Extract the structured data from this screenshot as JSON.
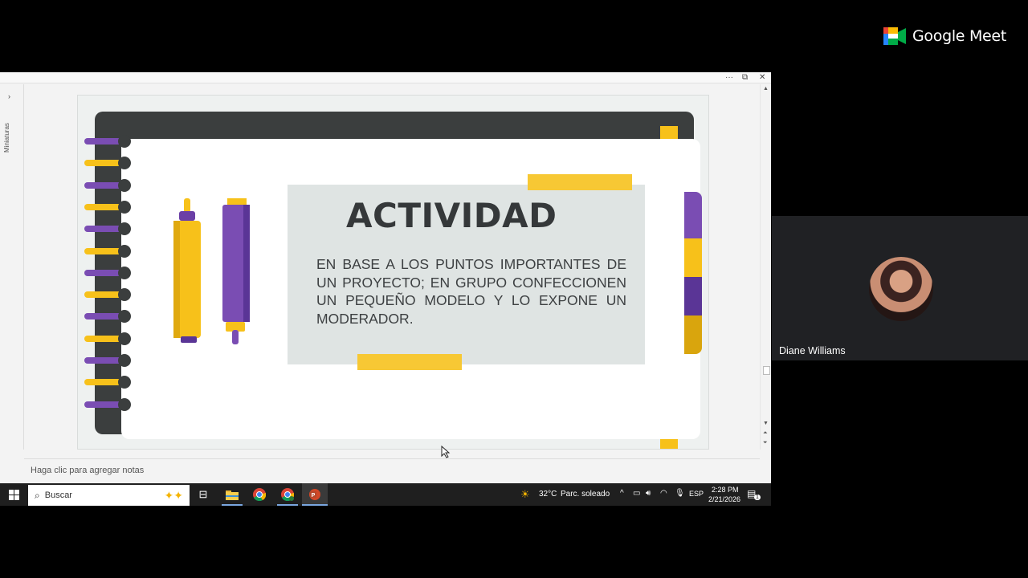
{
  "meet": {
    "brand_name": "Google Meet",
    "participant_name": "Diane Williams"
  },
  "powerpoint": {
    "window_controls": {
      "more": "···",
      "restore": "⧉",
      "close": "✕"
    },
    "thumbnails_label": "Miniaturas",
    "notes_placeholder": "Haga clic para agregar notas"
  },
  "slide": {
    "title": "ACTIVIDAD",
    "body": "EN BASE A LOS PUNTOS IMPORTANTES DE UN PROYECTO; EN GRUPO CONFECCIONEN UN PEQUEÑO MODELO Y LO EXPONE UN MODERADOR.",
    "colors": {
      "yellow": "#f7c11a",
      "purple": "#7a4db3",
      "dark": "#3b3e3e",
      "card": "#dfe4e3"
    }
  },
  "taskbar": {
    "search_label": "Buscar",
    "weather_temp": "32°C",
    "weather_desc": "Parc. soleado",
    "language": "ESP",
    "time": "2:28 PM",
    "date": "2/21/2026",
    "notification_count": "1",
    "icons": [
      "windows-start-icon",
      "search-icon",
      "task-view-icon",
      "file-explorer-icon",
      "chrome-icon",
      "chrome-profile-icon",
      "powerpoint-icon"
    ]
  }
}
